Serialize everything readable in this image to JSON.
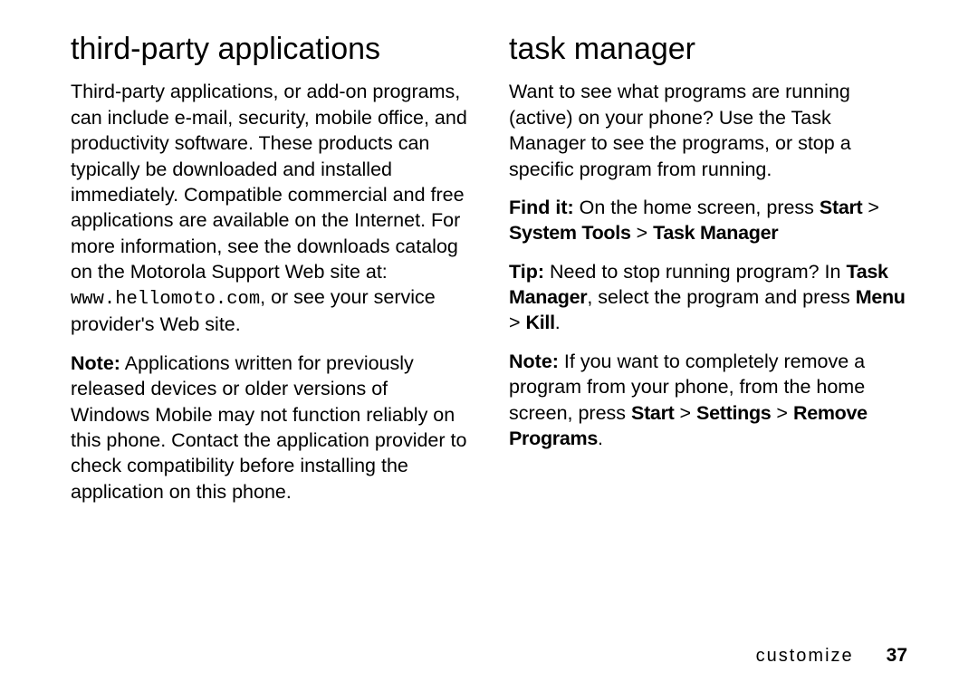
{
  "left": {
    "heading": "third-party applications",
    "p1_a": "Third-party applications, or add-on programs, can include e-mail, security, mobile office, and productivity software. These products can typically be downloaded and installed immediately. Compatible commercial and free applications are available on the Internet. For more information, see the downloads catalog on the Motorola Support Web site at: ",
    "p1_mono": "www.hellomoto.com",
    "p1_b": ", or see your service provider's Web site.",
    "p2_label": "Note:",
    "p2_body": " Applications written for previously released devices or older versions of Windows Mobile may not function reliably on this phone. Contact the application provider to check compatibility before installing the application on this phone."
  },
  "right": {
    "heading": "task manager",
    "p1": "Want to see what programs are running (active) on your phone? Use the Task Manager to see the programs, or stop a specific program from running.",
    "p2_label": "Find it:",
    "p2_a": " On the home screen, press ",
    "p2_b1": "Start",
    "p2_sep1": " > ",
    "p2_b2": "System Tools",
    "p2_sep2": " > ",
    "p2_b3": "Task Manager",
    "p3_label": "Tip:",
    "p3_a": " Need to stop running program? In ",
    "p3_b1": "Task Manager",
    "p3_b": ", select the program and press ",
    "p3_b2": "Menu",
    "p3_sep": " > ",
    "p3_b3": "Kill",
    "p3_end": ".",
    "p4_label": "Note:",
    "p4_a": " If you want to completely remove a program from your phone, from the home screen, press ",
    "p4_b1": "Start",
    "p4_sep1": " > ",
    "p4_b2": "Settings",
    "p4_sep2": " > ",
    "p4_b3": "Remove Programs",
    "p4_end": "."
  },
  "footer": {
    "section": "customize",
    "page": "37"
  }
}
